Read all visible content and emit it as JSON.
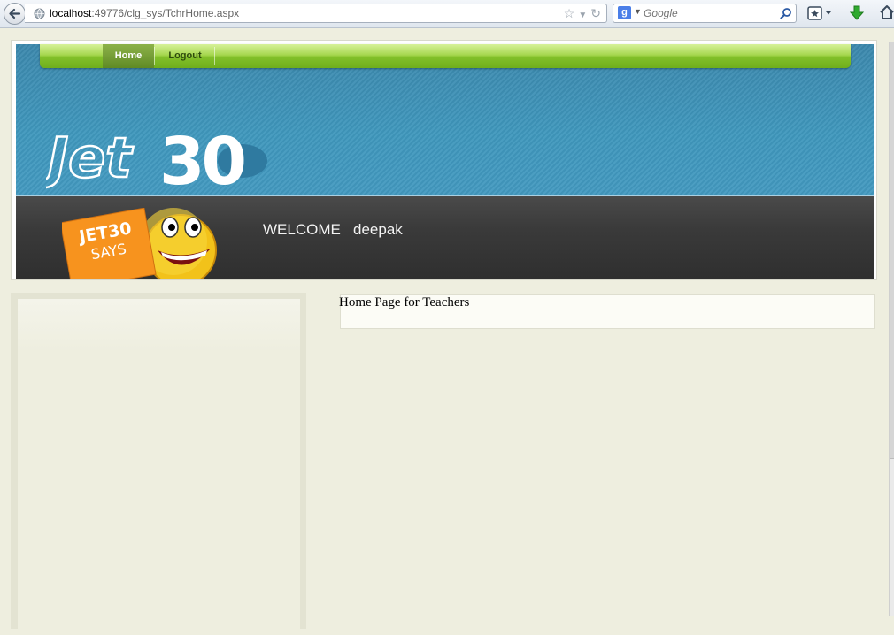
{
  "browser": {
    "url_host": "localhost",
    "url_rest": ":49776/clg_sys/TchrHome.aspx",
    "search_placeholder": "Google"
  },
  "nav": {
    "home_label": "Home",
    "logout_label": "Logout"
  },
  "header": {
    "logo_text_outline": "Jet",
    "logo_text_bold": "30",
    "welcome_label": "WELCOME",
    "username": "deepak",
    "mascot_badge_line1": "JET30",
    "mascot_badge_line2": "SAYS"
  },
  "content": {
    "heading": "Home Page for Teachers"
  },
  "colors": {
    "page_bg": "#eeeedf",
    "banner_blue": "#3f98bd",
    "nav_green": "#82c02a",
    "strip_dark": "#3a3a3a",
    "badge_orange": "#f7931e"
  },
  "icons": {
    "back": "back-arrow-icon",
    "globe": "globe-icon",
    "bookmark_star": "star-icon",
    "reload": "reload-icon",
    "search": "search-icon",
    "bookmarks": "bookmarks-icon",
    "download": "download-icon",
    "home": "home-icon"
  }
}
